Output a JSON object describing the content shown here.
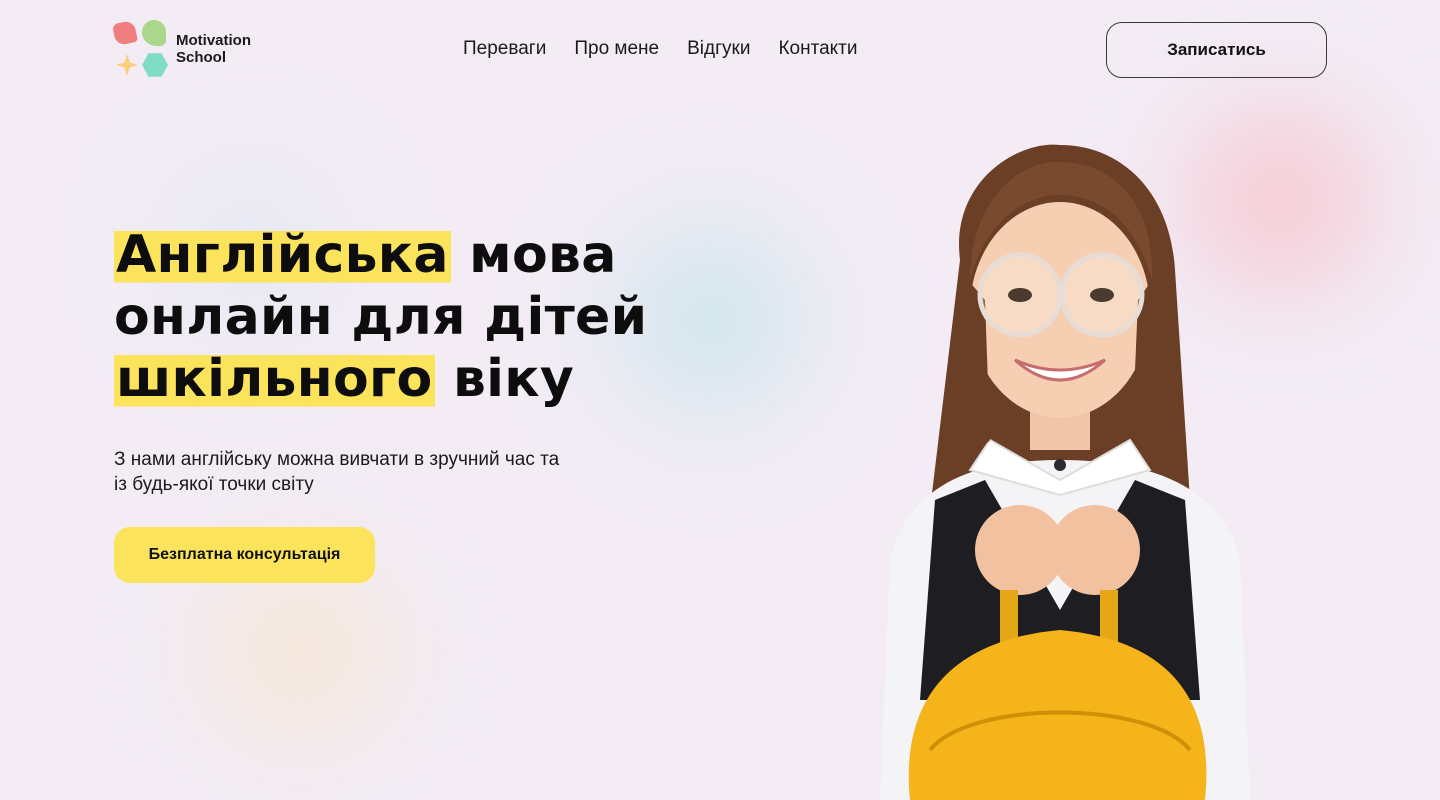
{
  "brand": {
    "line1": "Motivation",
    "line2": "School"
  },
  "nav": [
    {
      "label": "Переваги"
    },
    {
      "label": "Про мене"
    },
    {
      "label": "Відгуки"
    },
    {
      "label": "Контакти"
    }
  ],
  "header": {
    "signup_label": "Записатись"
  },
  "hero": {
    "title_hl1": "Англійська",
    "title_rest1": " мова",
    "title_line2": "онлайн для дітей",
    "title_hl2": "шкільного",
    "title_rest3": " віку",
    "subtitle": "З нами англійську можна вивчати в зручний час та із будь-якої точки світу",
    "cta_label": "Безплатна консультація"
  },
  "colors": {
    "accent_yellow": "#fbe45c",
    "background": "#f3ecf5",
    "text": "#111111"
  }
}
